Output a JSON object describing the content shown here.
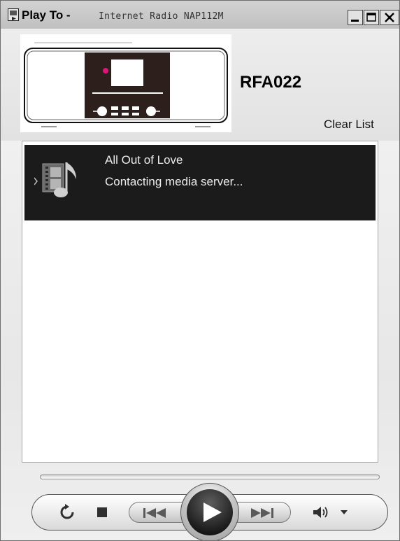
{
  "window": {
    "title_app": "Play To",
    "title_separator": " -",
    "title_device": "Internet Radio NAP112M"
  },
  "device": {
    "name": "RFA022"
  },
  "actions": {
    "clear_list_label": "Clear List"
  },
  "playlist": {
    "items": [
      {
        "title": "All Out of Love",
        "status": "Contacting media server..."
      }
    ]
  },
  "icons": {
    "app": "play-to-icon",
    "device": "internet-radio-device-image",
    "media": "music-note-icon",
    "repeat": "repeat-icon",
    "stop": "stop-icon",
    "previous": "previous-track-icon",
    "play": "play-icon",
    "next": "next-track-icon",
    "volume": "volume-icon",
    "dropdown": "chevron-down-icon"
  },
  "colors": {
    "indicator_led": "#e0157a",
    "now_playing_bg": "#1b1b1b"
  }
}
